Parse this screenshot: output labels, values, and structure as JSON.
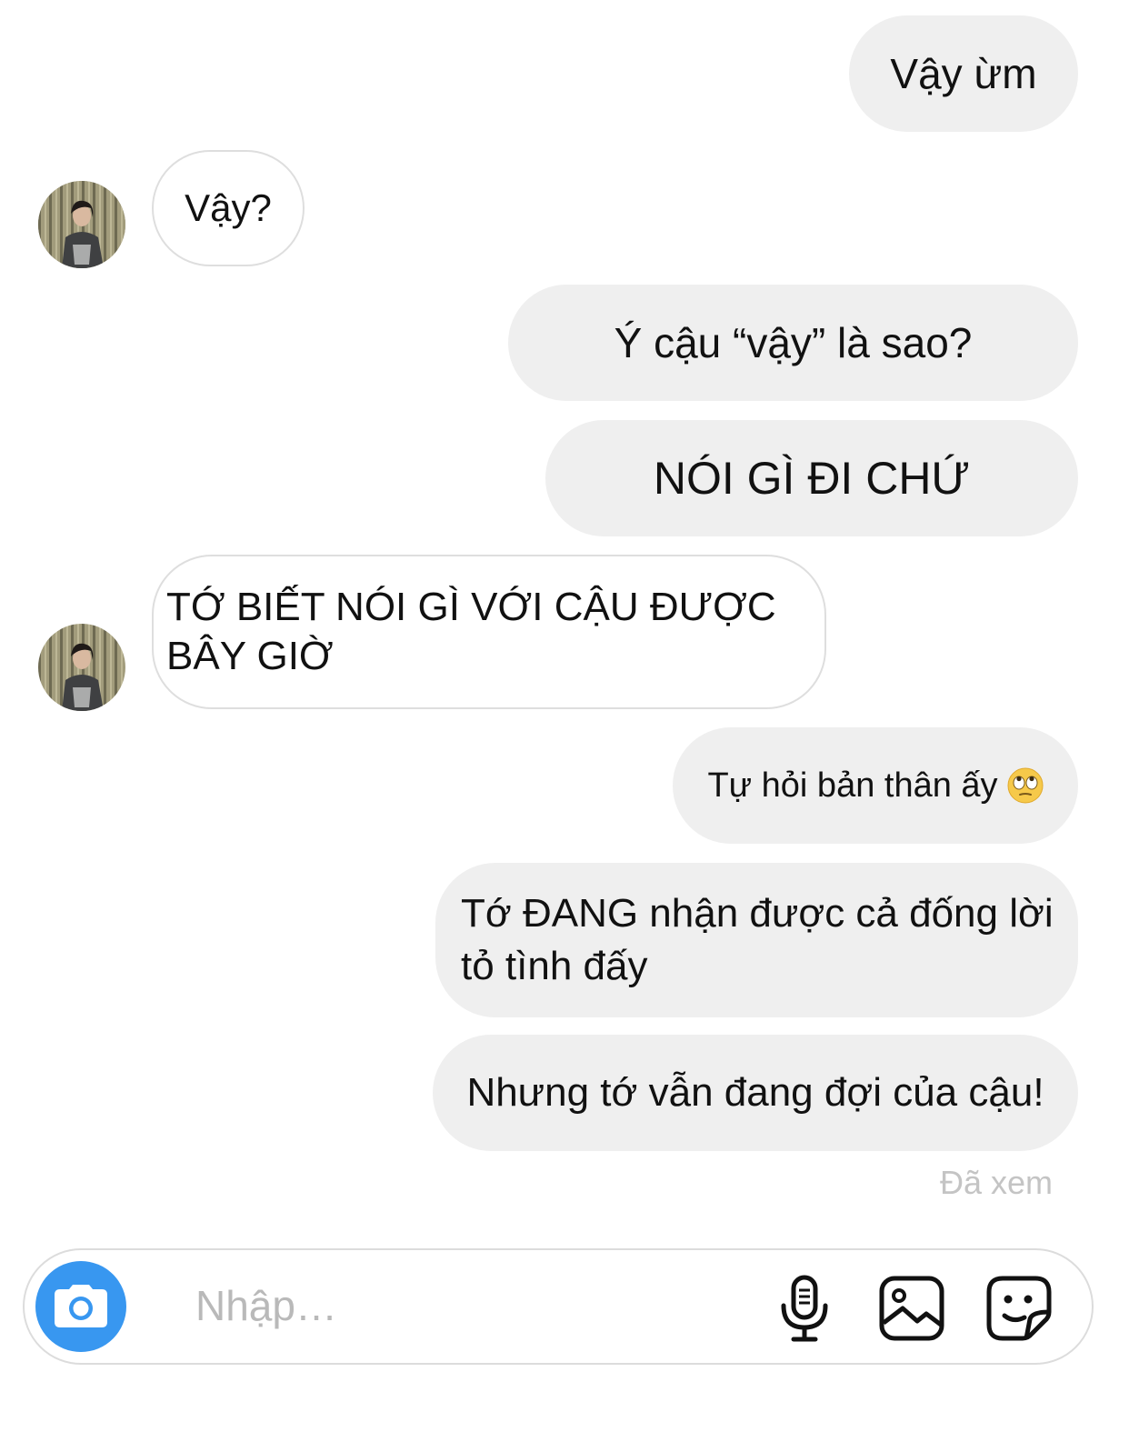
{
  "conversation": {
    "messages": [
      {
        "side": "outgoing",
        "text": "Vậy ừm"
      },
      {
        "side": "incoming",
        "text": "Vậy?"
      },
      {
        "side": "outgoing",
        "text": "Ý cậu “vậy” là sao?"
      },
      {
        "side": "outgoing",
        "text": "NÓI GÌ ĐI CHỨ"
      },
      {
        "side": "incoming",
        "text": "TỚ BIẾT NÓI GÌ VỚI CẬU ĐƯỢC BÂY GIỜ"
      },
      {
        "side": "outgoing",
        "text": "Tự hỏi bản thân ấy",
        "emoji": "eye-roll-emoji"
      },
      {
        "side": "outgoing",
        "text": "Tớ ĐANG nhận được cả đống lời tỏ tình đấy"
      },
      {
        "side": "outgoing",
        "text": "Nhưng tớ vẫn đang đợi của cậu!"
      }
    ],
    "seen_status": "Đã xem"
  },
  "composer": {
    "placeholder": "Nhập…",
    "value": "",
    "camera_icon": "camera-icon",
    "mic_icon": "microphone-icon",
    "gallery_icon": "image-gallery-icon",
    "sticker_icon": "sticker-icon"
  },
  "colors": {
    "outgoing_bubble": "#efefef",
    "incoming_border": "#dedede",
    "accent": "#3897f0",
    "seen_text": "#c4c4c4",
    "placeholder_text": "#b9b9b9"
  }
}
